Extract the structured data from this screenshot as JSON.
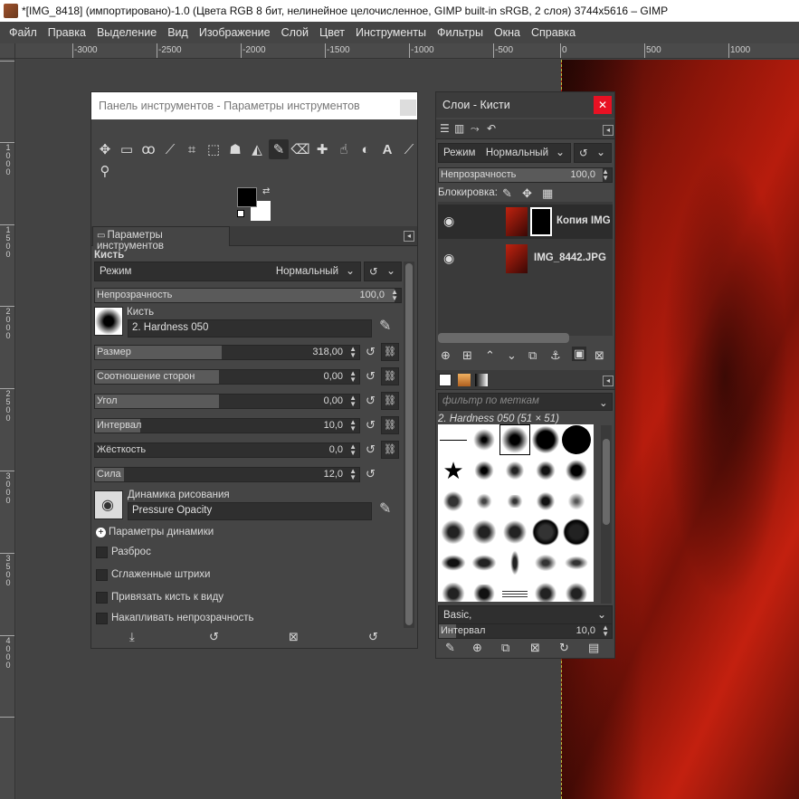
{
  "window": {
    "title": "*[IMG_8418] (импортировано)-1.0 (Цвета RGB 8 бит, нелинейное целочисленное, GIMP built-in sRGB, 2 слоя) 3744x5616 – GIMP"
  },
  "menu": [
    "Файл",
    "Правка",
    "Выделение",
    "Вид",
    "Изображение",
    "Слой",
    "Цвет",
    "Инструменты",
    "Фильтры",
    "Окна",
    "Справка"
  ],
  "ruler": {
    "labels": [
      "-3000",
      "-2500",
      "-2000",
      "-1500",
      "-1000",
      "-500",
      "0",
      "500",
      "1000"
    ],
    "vlabels": [
      "1",
      "0",
      "0",
      "0",
      "1",
      "5",
      "0",
      "0",
      "2",
      "0",
      "0",
      "0",
      "2",
      "5",
      "0",
      "0",
      "3",
      "0",
      "0",
      "0",
      "3",
      "5",
      "0",
      "0",
      "4",
      "0",
      "0",
      "0"
    ]
  },
  "tool_panel": {
    "title": "Панель инструментов - Параметры инструментов",
    "tools_row1": [
      "move-tool",
      "rect-select-tool",
      "lasso-tool",
      "fuzzy-select-tool",
      "crop-tool",
      "transform-tool",
      "warp-tool",
      "bucket-fill-tool",
      "paintbrush-tool",
      "eraser-tool",
      "heal-tool",
      "smudge-tool",
      "dodge-tool",
      "text-tool",
      "color-picker-tool"
    ],
    "tools_row2": [
      "zoom-tool"
    ],
    "colors": {
      "fg": "#000000",
      "bg": "#ffffff"
    },
    "tab": "Параметры инструментов",
    "section": "Кисть",
    "mode_label": "Режим",
    "mode_value": "Нормальный",
    "opacity_label": "Непрозрачность",
    "opacity_value": "100,0",
    "brush_label": "Кисть",
    "brush_value": "2. Hardness 050",
    "sliders": [
      {
        "label": "Размер",
        "value": "318,00",
        "fill": 0.48
      },
      {
        "label": "Соотношение сторон",
        "value": "0,00",
        "fill": 0.47
      },
      {
        "label": "Угол",
        "value": "0,00",
        "fill": 0.47
      },
      {
        "label": "Интервал",
        "value": "10,0",
        "fill": 0.17
      },
      {
        "label": "Жёсткость",
        "value": "0,0",
        "fill": 0.0
      },
      {
        "label": "Сила",
        "value": "12,0",
        "fill": 0.11
      }
    ],
    "dynamics_label": "Динамика рисования",
    "dynamics_value": "Pressure Opacity",
    "dynamics_params": "Параметры динамики",
    "checkboxes": [
      "Разброс",
      "Сглаженные штрихи",
      "Привязать кисть к виду",
      "Накапливать непрозрачность"
    ]
  },
  "layers_panel": {
    "title": "Слои - Кисти",
    "mode_label": "Режим",
    "mode_value": "Нормальный",
    "opacity_label": "Непрозрачность",
    "opacity_value": "100,0",
    "lock_label": "Блокировка:",
    "layers": [
      {
        "name": "Копия IMG",
        "selected": true
      },
      {
        "name": "IMG_8442.JPG",
        "selected": false
      }
    ],
    "brush_filter_placeholder": "фильтр по меткам",
    "brush_name": "2. Hardness 050 (51 × 51)",
    "brush_tag": "Basic,",
    "spacing_label": "Интервал",
    "spacing_value": "10,0"
  }
}
